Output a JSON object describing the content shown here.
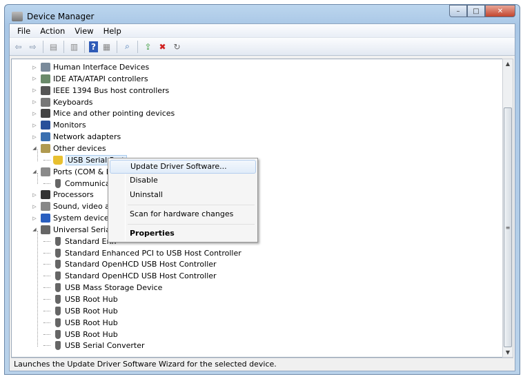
{
  "window": {
    "title": "Device Manager",
    "min": "–",
    "max": "□",
    "close": "✕"
  },
  "menubar": [
    "File",
    "Action",
    "View",
    "Help"
  ],
  "toolbar": [
    "back-icon",
    "forward-icon",
    "console-tree-icon",
    "properties-icon",
    "help-icon",
    "action-pane-icon",
    "scan-hardware-icon",
    "update-driver-icon",
    "uninstall-icon",
    "disable-icon"
  ],
  "tree": [
    {
      "label": "Human Interface Devices",
      "level": 0,
      "exp": "▷"
    },
    {
      "label": "IDE ATA/ATAPI controllers",
      "level": 0,
      "exp": "▷"
    },
    {
      "label": "IEEE 1394 Bus host controllers",
      "level": 0,
      "exp": "▷"
    },
    {
      "label": "Keyboards",
      "level": 0,
      "exp": "▷"
    },
    {
      "label": "Mice and other pointing devices",
      "level": 0,
      "exp": "▷"
    },
    {
      "label": "Monitors",
      "level": 0,
      "exp": "▷"
    },
    {
      "label": "Network adapters",
      "level": 0,
      "exp": "▷"
    },
    {
      "label": "Other devices",
      "level": 0,
      "exp": "◢"
    },
    {
      "label": "USB Serial Port",
      "level": 1,
      "selected": true
    },
    {
      "label": "Ports (COM & LF",
      "level": 0,
      "exp": "◢"
    },
    {
      "label": "Communicat",
      "level": 1
    },
    {
      "label": "Processors",
      "level": 0,
      "exp": "▷"
    },
    {
      "label": "Sound, video an",
      "level": 0,
      "exp": "▷"
    },
    {
      "label": "System devices",
      "level": 0,
      "exp": "▷"
    },
    {
      "label": "Universal Serial B",
      "level": 0,
      "exp": "◢"
    },
    {
      "label": "Standard Enh",
      "level": 1
    },
    {
      "label": "Standard Enhanced PCI to USB Host Controller",
      "level": 1
    },
    {
      "label": "Standard OpenHCD USB Host Controller",
      "level": 1
    },
    {
      "label": "Standard OpenHCD USB Host Controller",
      "level": 1
    },
    {
      "label": "USB Mass Storage Device",
      "level": 1
    },
    {
      "label": "USB Root Hub",
      "level": 1
    },
    {
      "label": "USB Root Hub",
      "level": 1
    },
    {
      "label": "USB Root Hub",
      "level": 1
    },
    {
      "label": "USB Root Hub",
      "level": 1
    },
    {
      "label": "USB Serial Converter",
      "level": 1
    }
  ],
  "context_menu": {
    "update": "Update Driver Software...",
    "disable": "Disable",
    "uninstall": "Uninstall",
    "scan": "Scan for hardware changes",
    "properties": "Properties"
  },
  "status": "Launches the Update Driver Software Wizard for the selected device."
}
